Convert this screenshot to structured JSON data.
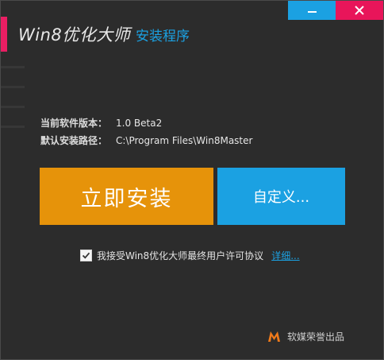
{
  "window": {
    "logo_text": "Win8优化大师",
    "subtitle": "安装程序",
    "minimize_icon": "minimize-icon",
    "close_icon": "close-icon"
  },
  "info": {
    "version_label": "当前软件版本：",
    "version_value": "1.0 Beta2",
    "path_label": "默认安装路径：",
    "path_value": "C:\\Program Files\\Win8Master"
  },
  "actions": {
    "install_label": "立即安装",
    "custom_label": "自定义..."
  },
  "agreement": {
    "checked": true,
    "text": "我接受Win8优化大师最终用户许可协议",
    "link_text": "详细..."
  },
  "footer": {
    "brand_text": "软媒荣誉出品",
    "logo_icon": "ruanmei-logo-icon"
  },
  "colors": {
    "accent_blue": "#1ba1e2",
    "accent_pink": "#e8155a",
    "install_orange": "#e6930a",
    "background": "#2c2c2c"
  }
}
